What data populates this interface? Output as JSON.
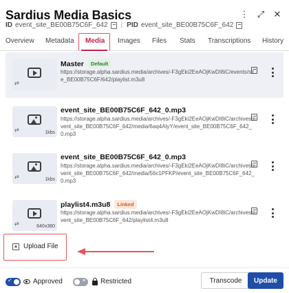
{
  "header": {
    "title": "Sardius Media Basics",
    "id_label": "ID",
    "id_value": "event_site_BE00B75C6F_642",
    "pid_label": "PID",
    "pid_value": "event_site_BE00B75C6F_642",
    "icons": [
      "more-vertical-icon",
      "expand-icon",
      "close-icon"
    ]
  },
  "tabs": [
    {
      "label": "Overview"
    },
    {
      "label": "Metadata"
    },
    {
      "label": "Media",
      "active": true
    },
    {
      "label": "Images"
    },
    {
      "label": "Files"
    },
    {
      "label": "Stats"
    },
    {
      "label": "Transcriptions"
    },
    {
      "label": "History"
    }
  ],
  "media_items": [
    {
      "title": "Master",
      "badge": "Default",
      "url": "https://storage.alpha.sardius.media/archives/-F3gEki2EeAOjKwDI8iC/events/site_BE00B75C6F/642/playlist.m3u8",
      "thumb_icon": "play-icon",
      "thumb_label": "",
      "selected": true
    },
    {
      "title": "event_site_BE00B75C6F_642_0.mp3",
      "badge": "",
      "url": "https://storage.alpha.sardius.media/archives/-F3gEki2EeAOjKwDI8iC/archives/event_site_BE00B75C6F_642/media/6aq4AlyY/event_site_BE00B75C6F_642_0.mp3",
      "thumb_icon": "image-icon",
      "thumb_label": "1kbs",
      "selected": false
    },
    {
      "title": "event_site_BE00B75C6F_642_0.mp3",
      "badge": "",
      "url": "https://storage.alpha.sardius.media/archives/-F3gEki2EeAOjKwDI8iC/archives/event_site_BE00B75C6F_642/media/56c1PFKP/event_site_BE00B75C6F_642_0.mp3",
      "thumb_icon": "image-icon",
      "thumb_label": "1kbs",
      "selected": false
    },
    {
      "title": "playlist4.m3u8",
      "badge": "Linked",
      "url": "https://storage.alpha.sardius.media/archives/-F3gEki2EeAOjKwDI8iC/archives/event_site_BE00B75C6F_642/playlist4.m3u8",
      "thumb_icon": "play-icon",
      "thumb_label": "640x360",
      "selected": false
    }
  ],
  "upload": {
    "label": "Upload File"
  },
  "footer": {
    "approved_label": "Approved",
    "approved_on": true,
    "restricted_label": "Restricted",
    "restricted_on": false,
    "transcode_label": "Transcode",
    "update_label": "Update"
  },
  "colors": {
    "accent": "#c0234a",
    "primary": "#1f4ea8",
    "highlight": "#e3555e"
  }
}
